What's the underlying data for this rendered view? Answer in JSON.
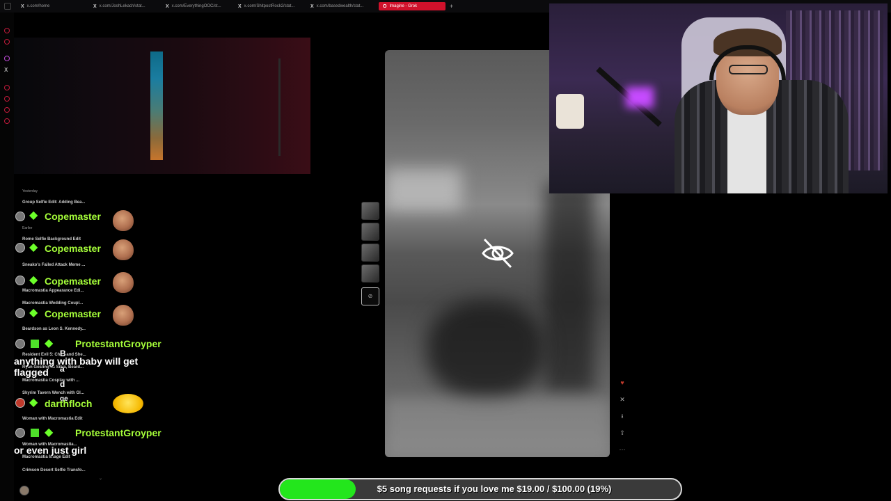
{
  "browser": {
    "tabs": [
      {
        "favicon": "X",
        "label": "x.com/home"
      },
      {
        "favicon": "X",
        "label": "x.com/JoshLekach/stat..."
      },
      {
        "favicon": "X",
        "label": "x.com/EverythingOOC/st..."
      },
      {
        "favicon": "X",
        "label": "x.com/ShitpostRock2/stat..."
      },
      {
        "favicon": "X",
        "label": "x.com/basedwealth/stat..."
      },
      {
        "favicon": "O",
        "label": "Imagine - Grok"
      }
    ],
    "new_tab": "+"
  },
  "history": {
    "groups": [
      {
        "label": "Yesterday"
      },
      {
        "label": "Earlier"
      }
    ],
    "items": [
      "Group Selfie Edit: Adding Bea...",
      "Rome Selfie Background Edit",
      "Sneako's Failed Attack Meme ...",
      "Macromastia Appearance Edi...",
      "Macromastia Wedding Coupl...",
      "Beardson as Leon S. Kennedy...",
      "Resident Evil 5: Chris and She...",
      "Ryan Gosling as Silva, Beard...",
      "Macromastia Cosplay with ...",
      "Skyrim Tavern Wench with Gl...",
      "Woman with Macromastia Edit",
      "Woman with Macromastia...",
      "Macromastia Image Edit",
      "Crimson Desert Selfie Transfo..."
    ]
  },
  "chat": {
    "messages": [
      {
        "user": "Copemaster"
      },
      {
        "user": "Copemaster"
      },
      {
        "user": "Copemaster"
      },
      {
        "user": "Copemaster"
      },
      {
        "user": "ProtestantGroyper",
        "text": "anything with baby will get flagged"
      },
      {
        "user": "darthfloch"
      },
      {
        "user": "ProtestantGroyper",
        "text": "or even just girl"
      }
    ],
    "bad_chars": [
      "B",
      "a",
      "d",
      "ge"
    ]
  },
  "viewer": {
    "hidden_icon": "eye-off-icon",
    "selected_thumb_icon": "eye-off-icon"
  },
  "actions": {
    "icons": [
      "heart-icon",
      "close-icon",
      "download-icon",
      "share-icon",
      "more-icon"
    ],
    "glyphs": [
      "♥",
      "✕",
      "⭳",
      "⇪",
      "···"
    ]
  },
  "goal": {
    "label": "$5 song requests if you love me $19.00 / $100.00 (19%)",
    "progress": 0.19,
    "color": "#23e61c"
  }
}
